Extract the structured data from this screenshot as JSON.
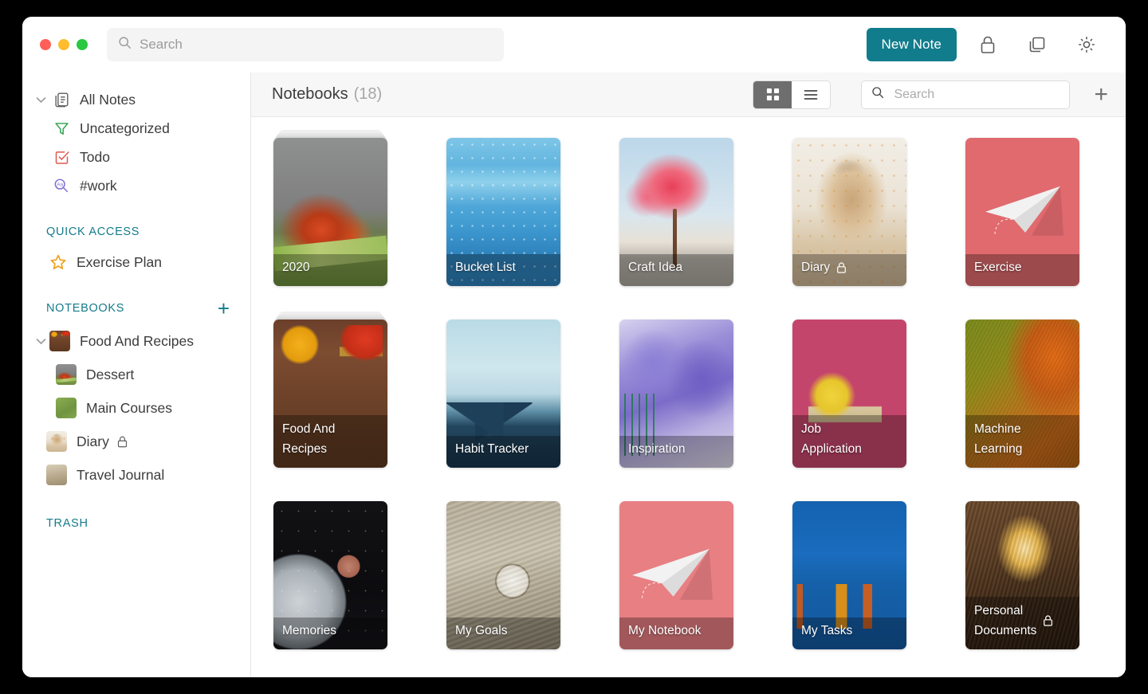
{
  "window": {
    "traffic_lights": [
      {
        "name": "close",
        "color": "#FF5F57"
      },
      {
        "name": "minimize",
        "color": "#FEBC2E"
      },
      {
        "name": "maximize",
        "color": "#28C840"
      }
    ]
  },
  "toolbar": {
    "search_placeholder": "Search",
    "search_value": "",
    "search_icon": "search-icon",
    "new_note_label": "New Note",
    "accent_color": "#117C8C",
    "icons": [
      {
        "name": "lock-icon",
        "label": "Lock"
      },
      {
        "name": "copy-icon",
        "label": "Duplicate"
      },
      {
        "name": "gear-icon",
        "label": "Settings"
      }
    ]
  },
  "sidebar": {
    "all_notes": {
      "label": "All Notes",
      "icon": "notes-icon",
      "expanded": true
    },
    "filters": [
      {
        "label": "Uncategorized",
        "icon": "funnel-icon",
        "color": "#2EA24A"
      },
      {
        "label": "Todo",
        "icon": "checkbox-icon",
        "color": "#E0564E"
      },
      {
        "label": "#work",
        "icon": "tag-search-icon",
        "color": "#7C6FD6"
      }
    ],
    "quick_access": {
      "title": "QUICK ACCESS",
      "items": [
        {
          "label": "Exercise Plan",
          "icon": "star-icon",
          "color": "#F0A020"
        }
      ]
    },
    "notebooks": {
      "title": "NOTEBOOKS",
      "add_icon": "plus-icon",
      "items": [
        {
          "label": "Food And Recipes",
          "thumb": "art-food",
          "expanded": true,
          "level": 0,
          "locked": false
        },
        {
          "label": "Dessert",
          "thumb": "art-2020",
          "level": 1,
          "locked": false
        },
        {
          "label": "Main Courses",
          "thumb": "art-maincourse",
          "level": 1,
          "locked": false
        },
        {
          "label": "Diary",
          "thumb": "art-diary",
          "level": 0,
          "locked": true
        },
        {
          "label": "Travel Journal",
          "thumb": "art-travel",
          "level": 0,
          "locked": false
        }
      ]
    },
    "trash": {
      "title": "TRASH"
    },
    "section_color": "#147B8C"
  },
  "content": {
    "title": "Notebooks",
    "count": "(18)",
    "view_toggle": {
      "active": "grid",
      "options": [
        {
          "name": "grid-view-icon",
          "value": "grid"
        },
        {
          "name": "list-view-icon",
          "value": "list"
        }
      ]
    },
    "search_placeholder": "Search",
    "search_value": "",
    "add_icon": "plus-icon",
    "notebooks": [
      {
        "title": "2020",
        "art": "art-2020",
        "stacked": true,
        "locked": false,
        "lines": 1
      },
      {
        "title": "Bucket List",
        "art": "art-bucket",
        "stacked": false,
        "locked": false,
        "lines": 1
      },
      {
        "title": "Craft Idea",
        "art": "art-craft",
        "stacked": false,
        "locked": false,
        "lines": 1
      },
      {
        "title": "Diary",
        "art": "art-diary",
        "stacked": false,
        "locked": true,
        "lines": 1
      },
      {
        "title": "Exercise",
        "art": "art-exercise",
        "stacked": false,
        "locked": false,
        "lines": 1
      },
      {
        "title": "Food And Recipes",
        "art": "art-food",
        "stacked": true,
        "locked": false,
        "lines": 2
      },
      {
        "title": "Habit Tracker",
        "art": "art-habit",
        "stacked": false,
        "locked": false,
        "lines": 1
      },
      {
        "title": "Inspiration",
        "art": "art-insp",
        "stacked": false,
        "locked": false,
        "lines": 1
      },
      {
        "title": "Job Application",
        "art": "art-job",
        "stacked": false,
        "locked": false,
        "lines": 2
      },
      {
        "title": "Machine Learning",
        "art": "art-ml",
        "stacked": false,
        "locked": false,
        "lines": 2
      },
      {
        "title": "Memories",
        "art": "art-mem",
        "stacked": false,
        "locked": false,
        "lines": 1
      },
      {
        "title": "My Goals",
        "art": "art-goals",
        "stacked": false,
        "locked": false,
        "lines": 1
      },
      {
        "title": "My Notebook",
        "art": "art-mynb",
        "stacked": false,
        "locked": false,
        "lines": 1
      },
      {
        "title": "My Tasks",
        "art": "art-tasks",
        "stacked": false,
        "locked": false,
        "lines": 1
      },
      {
        "title": "Personal Documents",
        "art": "art-docs",
        "stacked": false,
        "locked": true,
        "lines": 2
      }
    ]
  }
}
